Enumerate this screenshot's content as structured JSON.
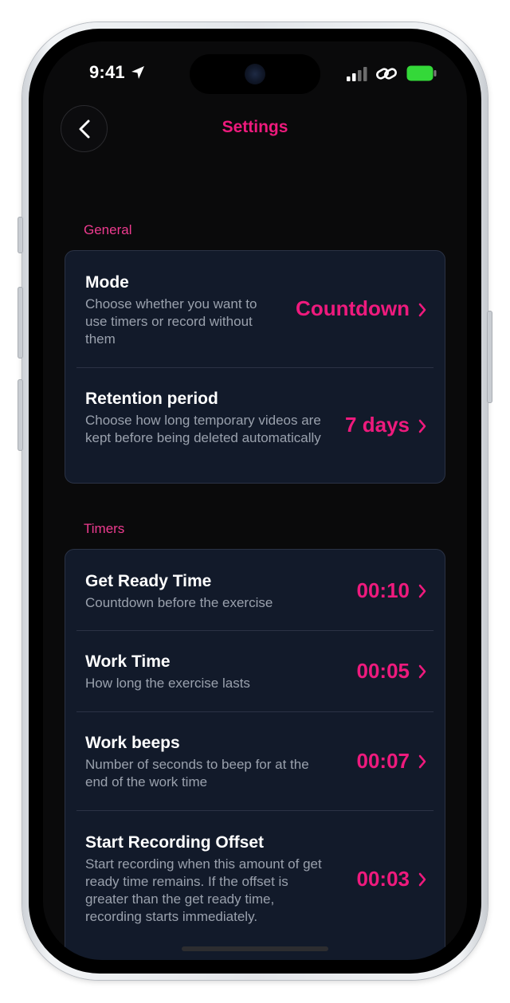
{
  "status_bar": {
    "time": "9:41"
  },
  "nav": {
    "title": "Settings"
  },
  "sections": [
    {
      "label": "General",
      "rows": [
        {
          "title": "Mode",
          "description": "Choose whether you want to use timers or record without them",
          "value": "Countdown"
        },
        {
          "title": "Retention period",
          "description": "Choose how long temporary videos are kept before being deleted automatically",
          "value": "7 days"
        }
      ]
    },
    {
      "label": "Timers",
      "rows": [
        {
          "title": "Get Ready Time",
          "description": "Countdown before the exercise",
          "value": "00:10"
        },
        {
          "title": "Work Time",
          "description": "How long the exercise lasts",
          "value": "00:05"
        },
        {
          "title": "Work beeps",
          "description": "Number of seconds to beep for at the end of the work time",
          "value": "00:07"
        },
        {
          "title": "Start Recording Offset",
          "description": "Start recording when this amount of get ready time remains. If the offset is greater than the get ready time, recording starts immediately.",
          "value": "00:03"
        }
      ]
    }
  ],
  "colors": {
    "accent": "#ee1a7d",
    "card": "#121a2a",
    "screen": "#0a0a0b",
    "battery": "#34d839"
  },
  "icons": [
    "location-arrow-icon",
    "signal-icon",
    "link-icon",
    "battery-icon",
    "chevron-left-icon",
    "chevron-right-icon"
  ]
}
